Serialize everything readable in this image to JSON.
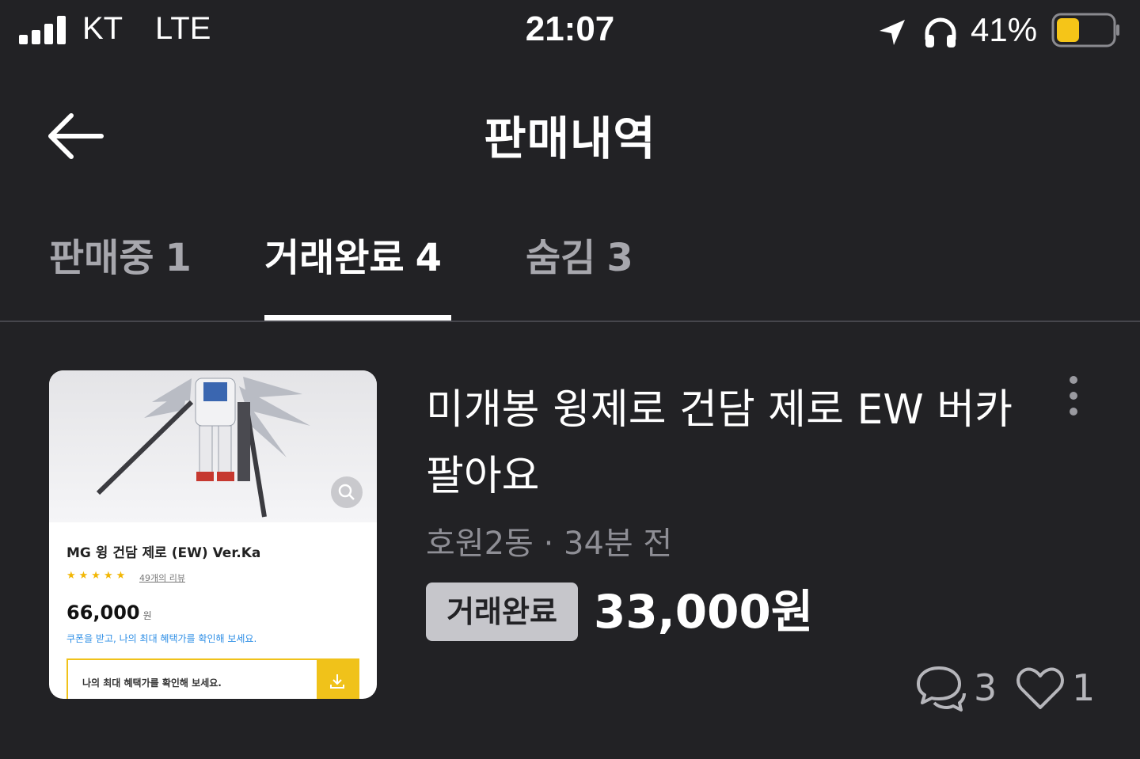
{
  "status_bar": {
    "carrier": "KT",
    "network": "LTE",
    "time": "21:07",
    "battery_percent": "41%",
    "battery_level": 0.41,
    "battery_color": "#f5c518"
  },
  "header": {
    "title": "판매내역",
    "back_icon": "arrow-left-icon"
  },
  "tabs": [
    {
      "label": "판매중",
      "count": "1",
      "active": false
    },
    {
      "label": "거래완료",
      "count": "4",
      "active": true
    },
    {
      "label": "숨김",
      "count": "3",
      "active": false
    }
  ],
  "item": {
    "title": "미개봉 윙제로 건담 제로 EW 버카 팔아요",
    "location": "호원2동",
    "time_ago": "34분 전",
    "status": "거래완료",
    "price": "33,000원",
    "chat_count": "3",
    "like_count": "1",
    "thumbnail": {
      "product_name": "MG 윙 건담 제로 (EW) Ver.Ka",
      "stars": "★★★★★",
      "reviews": "49개의 리뷰",
      "price": "66,000",
      "price_unit": "원",
      "coupon_text": "쿠폰을 받고, 나의 최대 혜택가를 확인해 보세요.",
      "box_text": "나의 최대 혜택가를 확인해 보세요."
    }
  },
  "colors": {
    "background": "#222225",
    "badge": "#c6c6cb",
    "accent_yellow": "#f0c21a"
  }
}
